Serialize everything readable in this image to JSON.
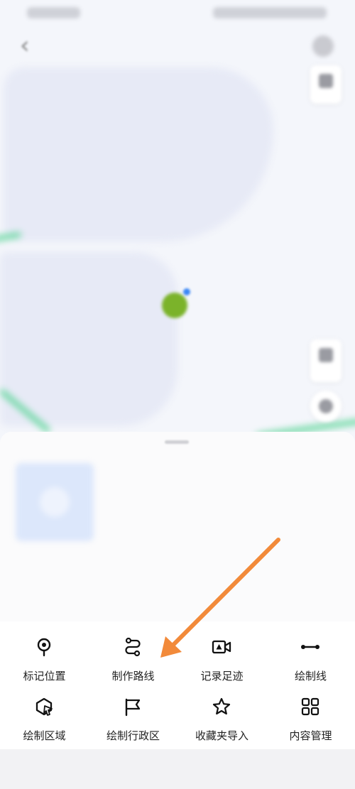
{
  "status_bar": {
    "left": "",
    "right": ""
  },
  "header": {
    "title": "",
    "back_label": "‹"
  },
  "map": {
    "place_label": "",
    "scale_label": ""
  },
  "sheet": {
    "title": "",
    "edit_label": "",
    "meta": "",
    "actions": "",
    "description": ""
  },
  "tools": {
    "row1": [
      {
        "label": "标记位置",
        "icon": "map-pin-icon"
      },
      {
        "label": "制作路线",
        "icon": "route-icon"
      },
      {
        "label": "记录足迹",
        "icon": "video-camera-icon"
      },
      {
        "label": "绘制线",
        "icon": "line-icon"
      }
    ],
    "row2": [
      {
        "label": "绘制区域",
        "icon": "draw-area-icon"
      },
      {
        "label": "绘制行政区",
        "icon": "flag-icon"
      },
      {
        "label": "收藏夹导入",
        "icon": "star-icon"
      },
      {
        "label": "内容管理",
        "icon": "grid-icon"
      }
    ]
  },
  "colors": {
    "arrow": "#f28a3a",
    "location_marker": "#7bb32a",
    "road": "#5fd69a",
    "accent_blue": "#3b87f5"
  }
}
